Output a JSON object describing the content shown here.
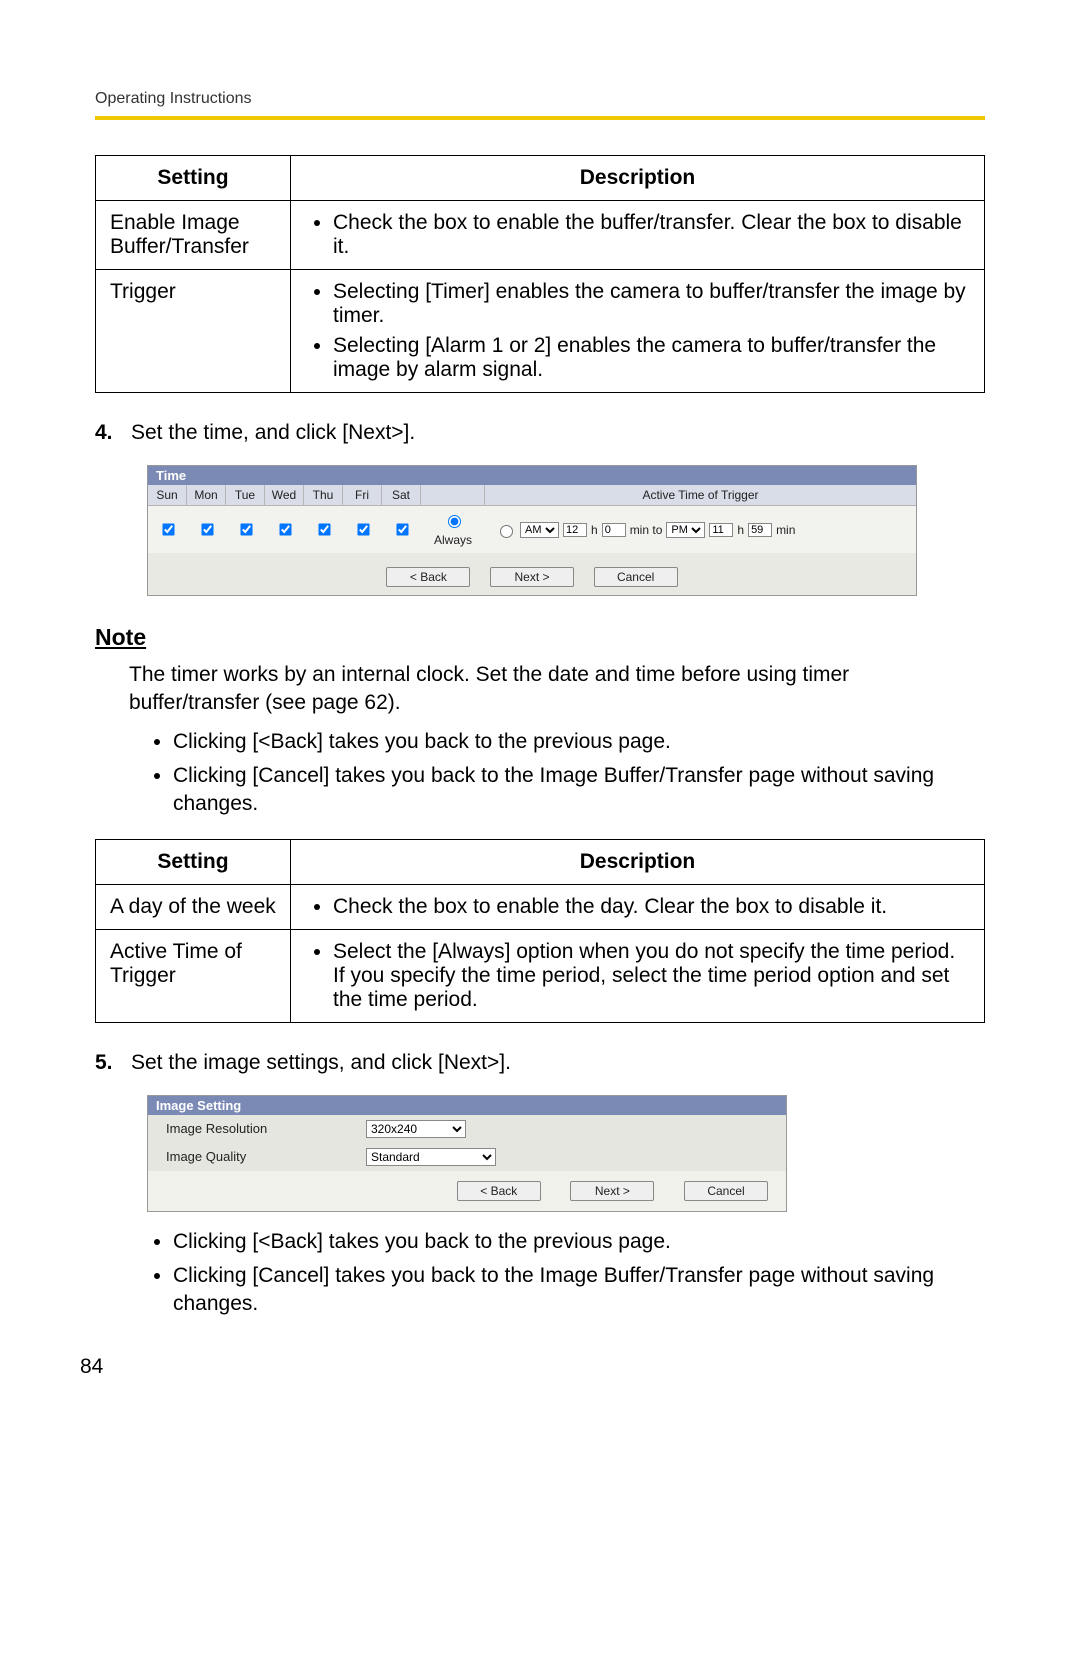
{
  "header": {
    "label": "Operating Instructions"
  },
  "page_number": "84",
  "table1": {
    "th_setting": "Setting",
    "th_desc": "Description",
    "rows": [
      {
        "setting": "Enable Image Buffer/Transfer",
        "items": [
          "Check the box to enable the buffer/transfer. Clear the box to disable it."
        ]
      },
      {
        "setting": "Trigger",
        "items": [
          "Selecting [Timer] enables the camera to buffer/transfer the image by timer.",
          "Selecting [Alarm 1 or 2] enables the camera to buffer/transfer the image by alarm signal."
        ]
      }
    ]
  },
  "step4": {
    "num": "4.",
    "text": "Set the time, and click [Next>]."
  },
  "time_panel": {
    "title": "Time",
    "days": [
      "Sun",
      "Mon",
      "Tue",
      "Wed",
      "Thu",
      "Fri",
      "Sat"
    ],
    "active_header": "Active Time of Trigger",
    "always_label": "Always",
    "from_ampm": "AM",
    "from_h": "12",
    "from_m": "0",
    "to_ampm": "PM",
    "to_h": "11",
    "to_m": "59",
    "h_label": "h",
    "min_label": "min",
    "minto_label": "min to",
    "back": "< Back",
    "next": "Next >",
    "cancel": "Cancel"
  },
  "note": {
    "heading": "Note",
    "body": "The timer works by an internal clock. Set the date and time before using timer buffer/transfer (see page 62).",
    "items": [
      "Clicking [<Back] takes you back to the previous page.",
      "Clicking [Cancel] takes you back to the Image Buffer/Transfer page without saving changes."
    ]
  },
  "table2": {
    "th_setting": "Setting",
    "th_desc": "Description",
    "rows": [
      {
        "setting": "A day of the week",
        "items": [
          "Check the box to enable the day. Clear the box to disable it."
        ]
      },
      {
        "setting": "Active Time of Trigger",
        "items": [
          "Select the [Always] option when you do not specify the time period. If you specify the time period, select the time period option and set the time period."
        ]
      }
    ]
  },
  "step5": {
    "num": "5.",
    "text": "Set the image settings, and click [Next>]."
  },
  "image_panel": {
    "title": "Image Setting",
    "res_label": "Image Resolution",
    "res_value": "320x240",
    "qual_label": "Image Quality",
    "qual_value": "Standard",
    "back": "< Back",
    "next": "Next >",
    "cancel": "Cancel"
  },
  "post_items": [
    "Clicking [<Back] takes you back to the previous page.",
    "Clicking [Cancel] takes you back to the Image Buffer/Transfer page without saving changes."
  ]
}
